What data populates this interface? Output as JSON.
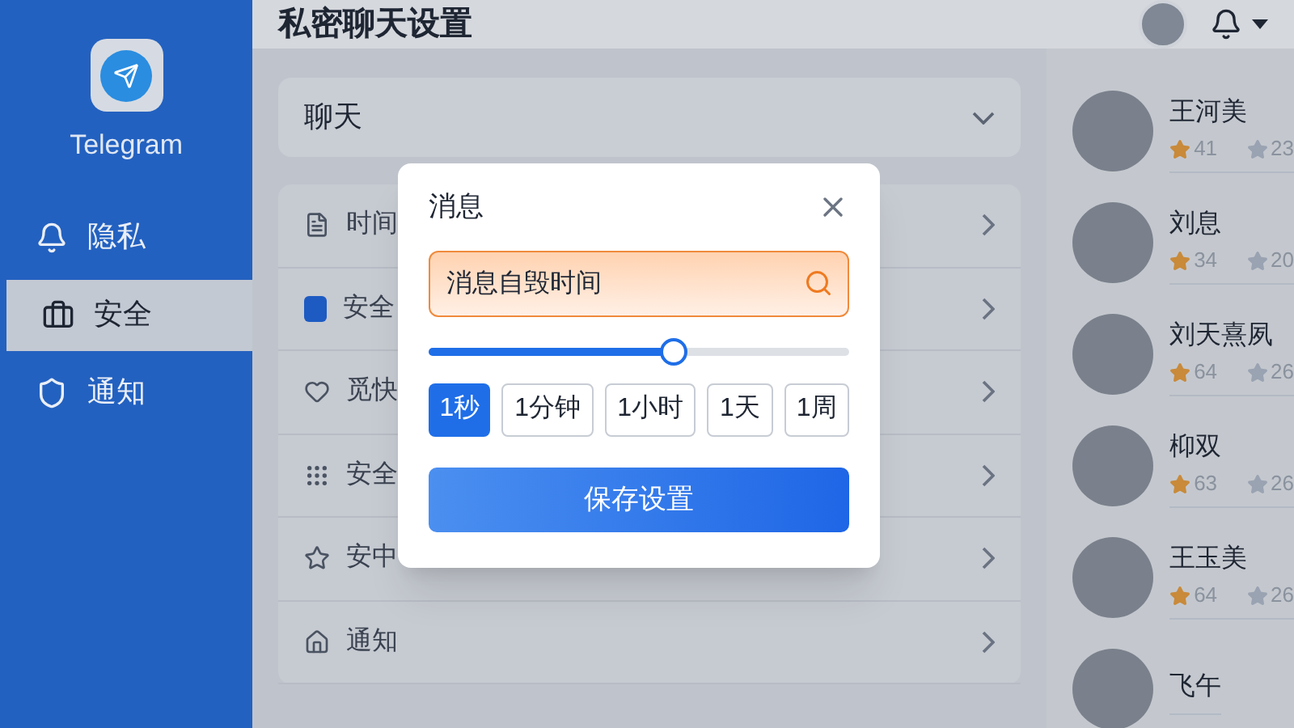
{
  "sidebar": {
    "app_name": "Telegram",
    "items": [
      {
        "label": "隐私",
        "selected": false
      },
      {
        "label": "安全",
        "selected": true
      },
      {
        "label": "通知",
        "selected": false
      }
    ]
  },
  "header": {
    "title": "私密聊天设置"
  },
  "section_dropdown": {
    "label": "聊天"
  },
  "settings_rows": [
    {
      "label": "时间"
    },
    {
      "label": "安全"
    },
    {
      "label": "觅快"
    },
    {
      "label": "安全"
    },
    {
      "label": "安中"
    },
    {
      "label": "通知"
    }
  ],
  "dialog": {
    "title": "消息",
    "search": {
      "value": "消息自毁时间"
    },
    "slider": {
      "level": 0.58
    },
    "options": [
      {
        "label": "1秒",
        "selected": true
      },
      {
        "label": "1分钟",
        "selected": false
      },
      {
        "label": "1小时",
        "selected": false
      },
      {
        "label": "1天",
        "selected": false
      },
      {
        "label": "1周",
        "selected": false
      }
    ],
    "save_button": "保存设置"
  },
  "contacts": [
    {
      "name": "王河美",
      "stat_1": "41",
      "stat_2": "23"
    },
    {
      "name": "刘息",
      "stat_1": "34",
      "stat_2": "20"
    },
    {
      "name": "刘天熹夙",
      "stat_1": "64",
      "stat_2": "26"
    },
    {
      "name": "枊双",
      "stat_1": "63",
      "stat_2": "26"
    },
    {
      "name": "王玉美",
      "stat_1": "64",
      "stat_2": "26"
    },
    {
      "name": "飞午"
    }
  ]
}
